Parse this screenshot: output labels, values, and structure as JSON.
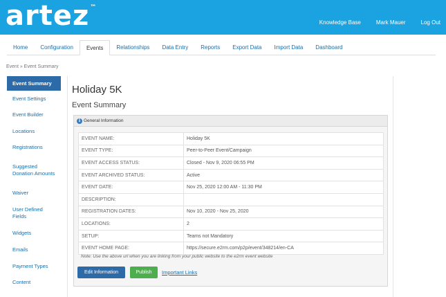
{
  "header": {
    "logo_text": "artez",
    "logo_tm": "™",
    "links": [
      "Knowledge Base",
      "Mark Mauer",
      "Log Out"
    ]
  },
  "nav": {
    "tabs": [
      "Home",
      "Configuration",
      "Events",
      "Relationships",
      "Data Entry",
      "Reports",
      "Export Data",
      "Import Data",
      "Dashboard"
    ],
    "active": "Events"
  },
  "breadcrumb": "Event » Event Summary",
  "sidebar": {
    "items": [
      "Event Summary",
      "Event Settings",
      "Event Builder",
      "Locations",
      "Registrations",
      "Suggested Donation Amounts",
      "Waiver",
      "User Defined Fields",
      "Widgets",
      "Emails",
      "Payment Types",
      "Content"
    ],
    "active": "Event Summary"
  },
  "page": {
    "title": "Holiday 5K",
    "subtitle": "Event Summary"
  },
  "panel": {
    "heading": "General Information",
    "rows": [
      {
        "label": "EVENT NAME:",
        "value": "Holiday 5K"
      },
      {
        "label": "EVENT TYPE:",
        "value": "Peer-to-Peer Event/Campaign"
      },
      {
        "label": "EVENT ACCESS STATUS:",
        "value": "Closed - Nov 9, 2020 06:55 PM"
      },
      {
        "label": "EVENT ARCHIVED STATUS:",
        "value": "Active"
      },
      {
        "label": "EVENT DATE:",
        "value": "Nov 25, 2020 12:00 AM - 11:30 PM"
      },
      {
        "label": "DESCRIPTION:",
        "value": ""
      },
      {
        "label": "REGISTRATION DATES:",
        "value": "Nov 10, 2020 - Nov 25, 2020"
      },
      {
        "label": "LOCATIONS:",
        "value": "2"
      },
      {
        "label": "SETUP:",
        "value": "Teams not Mandatory"
      },
      {
        "label": "EVENT HOME PAGE:",
        "value": "https://secure.e2rm.com/p2p/event/348214/en-CA"
      }
    ],
    "note": "Note: Use the above url when you are linking from your public website to the e2rm event website",
    "buttons": {
      "edit": "Edit Information",
      "publish": "Publish",
      "links": "Important Links"
    }
  }
}
